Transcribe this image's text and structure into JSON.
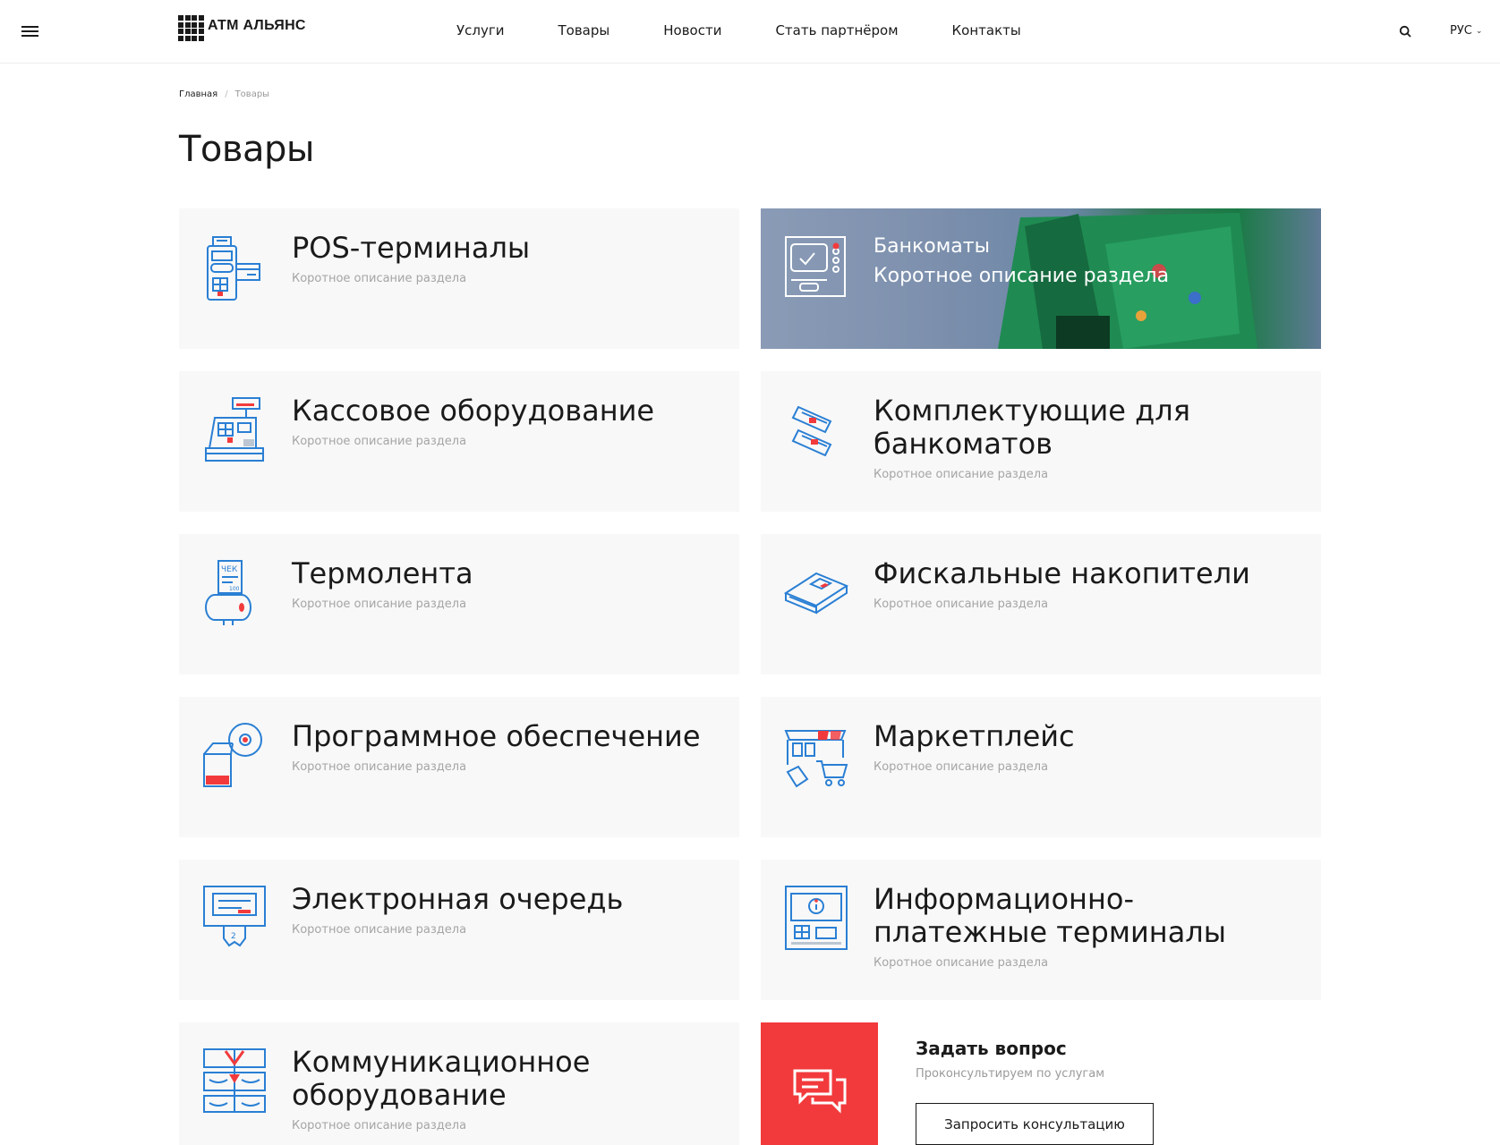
{
  "header": {
    "logo_text": "АТМ АЛЬЯНС",
    "nav": [
      "Услуги",
      "Товары",
      "Новости",
      "Стать партнёром",
      "Контакты"
    ],
    "lang": "РУС"
  },
  "breadcrumb": {
    "home": "Главная",
    "separator": "/",
    "current": "Товары"
  },
  "page_title": "Товары",
  "cards": [
    {
      "title": "POS-терминалы",
      "desc": "Коротное описание раздела",
      "icon": "pos-terminal-icon"
    },
    {
      "title": "Банкоматы",
      "desc": "Коротное описание раздела",
      "icon": "atm-icon"
    },
    {
      "title": "Кассовое оборудование",
      "desc": "Коротное описание раздела",
      "icon": "cash-register-icon"
    },
    {
      "title": "Комплектующие для банкоматов",
      "desc": "Коротное описание раздела",
      "icon": "atm-parts-icon"
    },
    {
      "title": "Термолента",
      "desc": "Коротное описание раздела",
      "icon": "thermal-tape-icon"
    },
    {
      "title": "Фискальные накопители",
      "desc": "Коротное описание раздела",
      "icon": "fiscal-drive-icon"
    },
    {
      "title": "Программное обеспечение",
      "desc": "Коротное описание раздела",
      "icon": "software-icon"
    },
    {
      "title": "Маркетплейс",
      "desc": "Коротное описание раздела",
      "icon": "marketplace-icon"
    },
    {
      "title": "Электронная очередь",
      "desc": "Коротное описание раздела",
      "icon": "queue-icon"
    },
    {
      "title": "Информационно-платежные терминалы",
      "desc": "Коротное описание раздела",
      "icon": "payment-terminal-icon"
    },
    {
      "title": "Коммуникационное оборудование",
      "desc": "Коротное описание раздела",
      "icon": "communication-icon"
    }
  ],
  "ask": {
    "title": "Задать вопрос",
    "subtitle": "Проконсультируем по услугам",
    "button": "Запросить консультацию"
  },
  "colors": {
    "accent_red": "#f23a3c",
    "icon_blue": "#2a7fd4",
    "card_bg": "#f8f8f8"
  }
}
